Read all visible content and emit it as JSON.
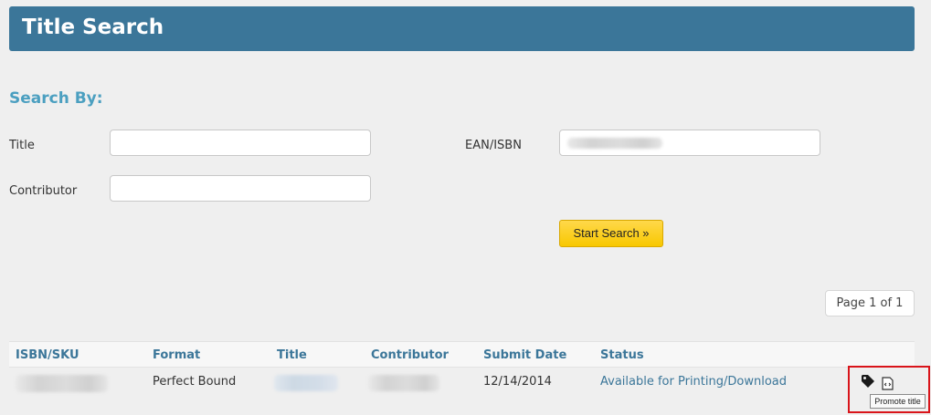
{
  "header": {
    "title": "Title Search"
  },
  "search": {
    "heading": "Search By:",
    "title_label": "Title",
    "title_value": "",
    "ean_label": "EAN/ISBN",
    "contributor_label": "Contributor",
    "contributor_value": "",
    "start_button": "Start Search »"
  },
  "pagination": {
    "label": "Page 1 of 1"
  },
  "table": {
    "columns": [
      "ISBN/SKU",
      "Format",
      "Title",
      "Contributor",
      "Submit Date",
      "Status"
    ],
    "rows": [
      {
        "format": "Perfect Bound",
        "submit_date": "12/14/2014",
        "status": "Available for Printing/Download"
      }
    ]
  },
  "tooltip": {
    "text": "Promote title"
  },
  "icons": {
    "tag": "tag-icon",
    "file": "file-code-icon"
  },
  "colors": {
    "header": "#3b7699",
    "accent": "#4b9fc0",
    "button": "#f8c800",
    "highlight": "#d9141a"
  }
}
